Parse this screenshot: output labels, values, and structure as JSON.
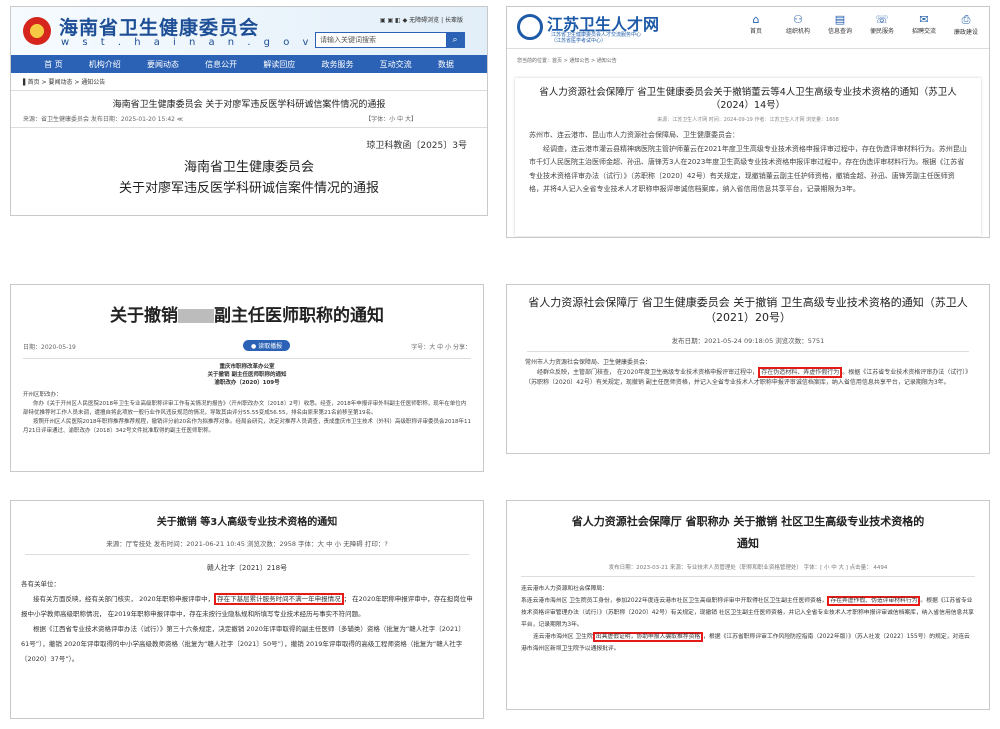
{
  "p1": {
    "site_title": "海南省卫生健康委员会",
    "site_url": "w s t . h a i n a n . g o v . c n",
    "toplinks": "▣ ▣ ◧ ◆ 无障碍浏览 | 长辈版",
    "search_placeholder": "请输入关键词搜索",
    "nav": [
      "首 页",
      "机构介绍",
      "要闻动态",
      "信息公开",
      "解读回应",
      "政务服务",
      "互动交流",
      "数据"
    ],
    "breadcrumb": "▌首页 > 要闻动态 > 通知公告",
    "article_title": "海南省卫生健康委员会 关于对廖军违反医学科研诚信案件情况的通报",
    "meta": "来源：省卫生健康委员会   发布日期：2025-01-20 15:42  ≪",
    "font_size": "【字体：小 中 大】",
    "doc_no": "琼卫科教函〔2025〕3号",
    "heading1": "海南省卫生健康委员会",
    "heading2": "关于对廖军违反医学科研诚信案件情况的通报"
  },
  "p2": {
    "site_title": "江苏卫生人才网",
    "site_sub1": "江苏省卫生健康委员会人才交流服务中心",
    "site_sub2": "（江苏省医学考试中心）",
    "nav": [
      {
        "icon": "⌂",
        "label": "首页"
      },
      {
        "icon": "⚇",
        "label": "组织机构"
      },
      {
        "icon": "▤",
        "label": "信息查询"
      },
      {
        "icon": "☏",
        "label": "便民服务"
      },
      {
        "icon": "✉",
        "label": "招聘交流"
      },
      {
        "icon": "⎙",
        "label": "廉政建设"
      }
    ],
    "breadcrumb": "您当前的位置：首页 > 通知公告 > 通知公告",
    "article_title": "省人力资源社会保障厅 省卫生健康委员会关于撤销董云等4人卫生高级专业技术资格的通知（苏卫人（2024）14号）",
    "meta": "来源：江苏卫生人才网   时间：2024-09-19   作者：江苏卫生人才网   浏览量：1608",
    "body1": "苏州市、连云港市、昆山市人力资源社会保障局、卫生健康委员会：",
    "body2": "经调查，连云港市灌云县精神病医院主管护师董云在2021年度卫生高级专业技术资格申报评审过程中，存在伪造评审材料行为。苏州昆山市千灯人民医院主治医师金超、孙迅、唐锋芳3人在2023年度卫生高级专业技术资格申报评审过程中，存在伪造评审材料行为。根据《江苏省专业技术资格评审办法（试行）》（苏职称〔2020〕42号）有关规定，现撤销董云副主任护师资格，撤销金超、孙迅、唐锋芳副主任医师资格，并将4人记入全省专业技术人才职称申报评审诚信档案库，纳入省信用信息共享平台，记录期限为3年。"
  },
  "p3": {
    "title_a": "关于撤销",
    "title_b": "副主任医师职称的通知",
    "date": "日期：2020-05-19",
    "pill": "● 读取播报",
    "right": "字号：大 中 小    分享：",
    "c1": "重庆市职称改革办公室",
    "c2": "关于撤销      副主任医师职称的通知",
    "c3": "渝职改办〔2020〕109号",
    "body1": "开州区职改办：",
    "body2": "你办《关于开州区人民医院2018年卫生专业高级职称评审工作有关情况的报告》（开州职改办文〔2018〕2号）收悉。经查，2018年申报评审外科副主任医师职称，现年在单位内部特优推荐时工作人员未调，遭擅自将此项放一般行业作风违反规范的情况，导致其由评分55.55变成56.55，排名由原来第21名前移至第19名。",
    "body3": "按照开州区人民医院2018年职称推荐推荐规程，撤销评分前20名作为拟推荐对象。经局会研究，决定对推荐人员调查，责成重庆市卫生技术（外科）高级职称评审委员会2018年11月21日评审通过、渝职改办〔2018〕342号文件批准取得的副主任医师职称。"
  },
  "p4": {
    "title": "省人力资源社会保障厅 省卫生健康委员会 关于撤销           卫生高级专业技术资格的通知（苏卫人（2021）20号）",
    "meta": "发布日期：2021-05-24 09:18:05                浏览次数：5751",
    "body1": "常州市人力资源社会保障局、卫生健康委员会：",
    "body2a": "经群众反映，主管部门核查，                                    在2020年度卫生高级专业技术资格申报评审过程中，",
    "hl1": "存在伪造材料、弄虚作假行为",
    "body2b": "。根据《江苏省专业技术资格评审办法（试行）》（苏职称〔2020〕42号）有关规定，现撤销        副主任医师资格，并记入全省专业技术人才职称申报评审诚信档案库，纳入省信用信息共享平台，记录期限为3年。"
  },
  "p5": {
    "title": "关于撤销        等3人高级专业技术资格的通知",
    "meta": "来源：厅专技处   发布时间：2021-06-21 10:45   浏览次数：2958   字体：大 中 小   无障碍   打印：?",
    "doc_no": "赣人社字〔2021〕218号",
    "body1": "各有关单位：",
    "body2a": "接有关方面反映，经有关部门核实，                                      2020年职称申报评审中，",
    "hl1": "存在下基层累计服务时间不满一年申报情况",
    "body2b": "；                              在2020年职称申报评审中，存在担岗位申报中小学教师高级职称情况，                              在2019年职称申报评审中，存在未按行业隐私规和所填写专业技术经历与事实不符问题。",
    "body3": "根据《江西省专业技术资格评审办法（试行）》第三十六条规定，决定撤销               2020年评审取得的副主任医师（多辅类）资格（批复为“赣人社字〔2021〕61号”），撤销                  2020年评审取得的中小学高级教师资格（批复为“赣人社字〔2021〕50号”），撤销              2019年评审取得的高级工程师资格（批复为“赣人社字〔2020〕37号”）。"
  },
  "p6": {
    "title1": "省人力资源社会保障厅 省职称办 关于撤销          社区卫生高级专业技术资格的",
    "title2": "通知",
    "meta": "发布日期：2023-03-21    来源：专业技术人员管理处（职称和职业资格管理处）    字体：[ 小 中 大 ]    点击量：        4494",
    "body1": "连云港市人力资源和社会保障局：",
    "body2a": "                系连云港市海州区              卫生院员工身份，参加2022年度连云港市社区卫生高级职称评审中开取得社区卫生副主任医师资格，",
    "hl1": "存在弄虚作假、伪造评审材料行为",
    "body2b": "。根据《江苏省专业技术资格评审管理办法（试行）》（苏职称〔2020〕42号）有关规定，现撤销           社区卫生副主任医师资格，并记入全省专业技术人才职称申报评审诚信档案库，纳入省信用信息共享平台，记录期限为3年。",
    "body3a": "连云港市海州区              卫生院",
    "hl2": "出具虚假证明，协助申报人骗取推荐资格",
    "body3b": "，根据《江苏省职称评审工作风险防控指南（2022年版）》（苏人社发〔2022〕155号）的规定，对连云港市海州区新坝卫生院予以通报批评。"
  }
}
